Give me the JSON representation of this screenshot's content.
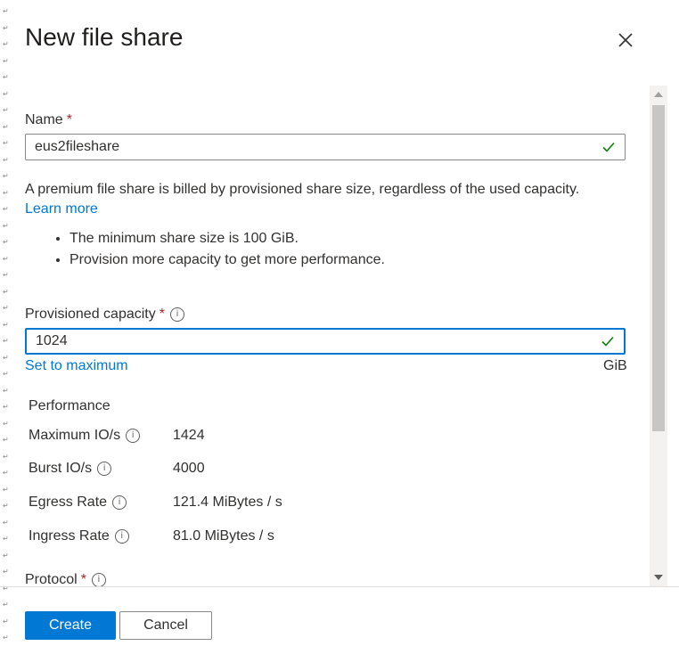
{
  "dialog": {
    "title": "New file share",
    "close_icon": "close-icon"
  },
  "name_field": {
    "label": "Name",
    "required_mark": "*",
    "value": "eus2fileshare",
    "valid_icon": "checkmark-icon"
  },
  "billing": {
    "description": "A premium file share is billed by provisioned share size, regardless of the used capacity.",
    "learn_more": "Learn more",
    "bullets": [
      "The minimum share size is 100 GiB.",
      "Provision more capacity to get more performance."
    ]
  },
  "capacity_field": {
    "label": "Provisioned capacity",
    "required_mark": "*",
    "info_icon": "info-icon",
    "value": "1024",
    "set_max": "Set to maximum",
    "unit": "GiB"
  },
  "performance": {
    "heading": "Performance",
    "rows": [
      {
        "label": "Maximum IO/s",
        "value": "1424"
      },
      {
        "label": "Burst IO/s",
        "value": "4000"
      },
      {
        "label": "Egress Rate",
        "value": "121.4 MiBytes / s"
      },
      {
        "label": "Ingress Rate",
        "value": "81.0 MiBytes / s"
      }
    ]
  },
  "protocol": {
    "label": "Protocol",
    "required_mark": "*"
  },
  "footer": {
    "create": "Create",
    "cancel": "Cancel"
  }
}
